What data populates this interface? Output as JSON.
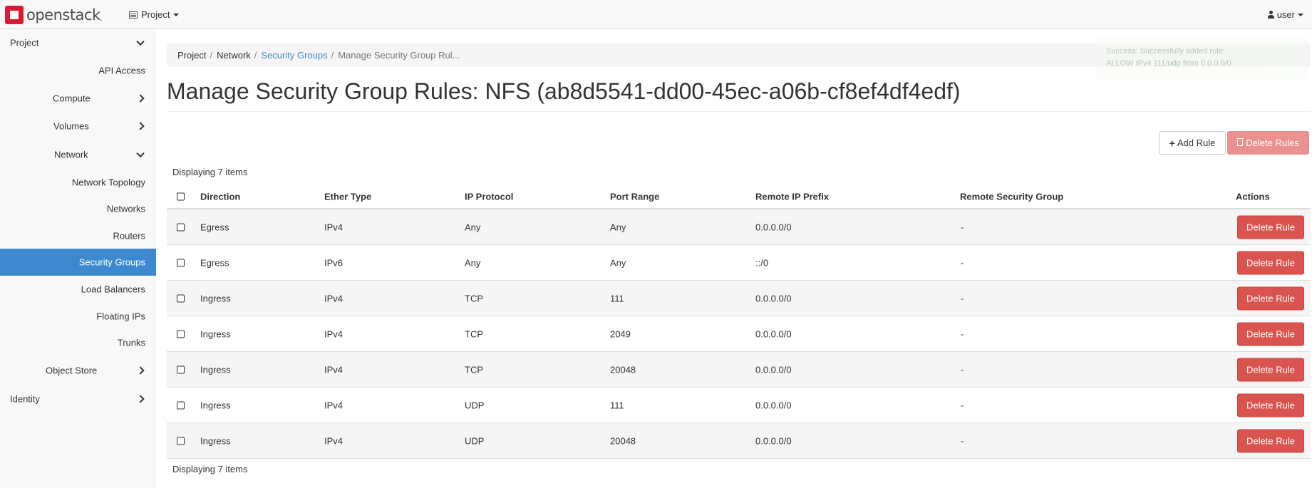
{
  "navbar": {
    "brand": "openstack",
    "project_label": "Project",
    "user_label": "user"
  },
  "sidebar": {
    "items": [
      {
        "label": "Project"
      },
      {
        "label": "API Access"
      },
      {
        "label": "Compute"
      },
      {
        "label": "Volumes"
      },
      {
        "label": "Network"
      },
      {
        "label": "Network Topology"
      },
      {
        "label": "Networks"
      },
      {
        "label": "Routers"
      },
      {
        "label": "Security Groups"
      },
      {
        "label": "Load Balancers"
      },
      {
        "label": "Floating IPs"
      },
      {
        "label": "Trunks"
      },
      {
        "label": "Object Store"
      },
      {
        "label": "Identity"
      }
    ]
  },
  "breadcrumb": [
    "Project",
    "Network",
    "Security Groups",
    "Manage Security Group Rul..."
  ],
  "toast": {
    "line1": "Success: Successfully added rule:",
    "line2": "ALLOW IPv4 111/udp from 0.0.0.0/0"
  },
  "page_title": "Manage Security Group Rules: NFS (ab8d5541-dd00-45ec-a06b-cf8ef4df4edf)",
  "actions": {
    "add_rule": "Add Rule",
    "delete_rules": "Delete Rules"
  },
  "table": {
    "count_top": "Displaying 7 items",
    "count_bottom": "Displaying 7 items",
    "headers": [
      "Direction",
      "Ether Type",
      "IP Protocol",
      "Port Range",
      "Remote IP Prefix",
      "Remote Security Group",
      "Actions"
    ],
    "row_action": "Delete Rule",
    "rows": [
      [
        "Egress",
        "IPv4",
        "Any",
        "Any",
        "0.0.0.0/0",
        "-"
      ],
      [
        "Egress",
        "IPv6",
        "Any",
        "Any",
        "::/0",
        "-"
      ],
      [
        "Ingress",
        "IPv4",
        "TCP",
        "111",
        "0.0.0.0/0",
        "-"
      ],
      [
        "Ingress",
        "IPv4",
        "TCP",
        "2049",
        "0.0.0.0/0",
        "-"
      ],
      [
        "Ingress",
        "IPv4",
        "TCP",
        "20048",
        "0.0.0.0/0",
        "-"
      ],
      [
        "Ingress",
        "IPv4",
        "UDP",
        "111",
        "0.0.0.0/0",
        "-"
      ],
      [
        "Ingress",
        "IPv4",
        "UDP",
        "20048",
        "0.0.0.0/0",
        "-"
      ]
    ]
  }
}
